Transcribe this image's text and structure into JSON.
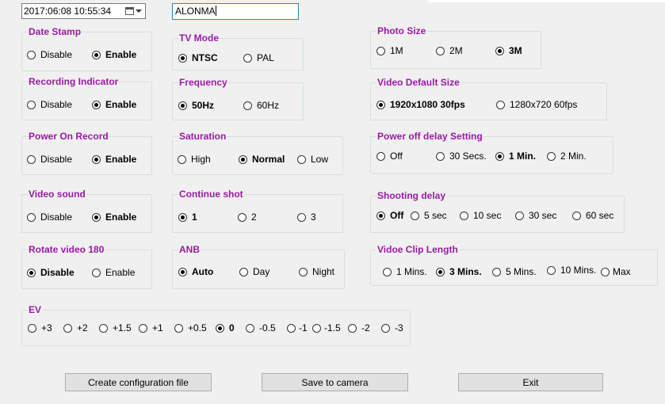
{
  "datetime_field": {
    "value": "2017:06:08 10:55:34"
  },
  "name_field": {
    "value": "ALONMA"
  },
  "groups": {
    "date_stamp": {
      "title": "Date Stamp",
      "options": [
        "Disable",
        "Enable"
      ]
    },
    "tv_mode": {
      "title": "TV Mode",
      "options": [
        "NTSC",
        "PAL"
      ]
    },
    "photo_size": {
      "title": "Photo Size",
      "options": [
        "1M",
        "2M",
        "3M"
      ]
    },
    "recording_indicator": {
      "title": "Recording Indicator",
      "options": [
        "Disable",
        "Enable"
      ]
    },
    "frequency": {
      "title": "Frequency",
      "options": [
        "50Hz",
        "60Hz"
      ]
    },
    "video_default_size": {
      "title": "Video Default Size",
      "options": [
        "1920x1080 30fps",
        "1280x720 60fps"
      ]
    },
    "power_on_record": {
      "title": "Power On Record",
      "options": [
        "Disable",
        "Enable"
      ]
    },
    "saturation": {
      "title": "Saturation",
      "options": [
        "High",
        "Normal",
        "Low"
      ]
    },
    "power_off_delay": {
      "title": "Power off delay Setting",
      "options": [
        "Off",
        "30 Secs.",
        "1 Min.",
        "2 Min."
      ]
    },
    "video_sound": {
      "title": "Video sound",
      "options": [
        "Disable",
        "Enable"
      ]
    },
    "continue_shot": {
      "title": "Continue shot",
      "options": [
        "1",
        "2",
        "3"
      ]
    },
    "shooting_delay": {
      "title": "Shooting delay",
      "options": [
        "Off",
        "5 sec",
        "10 sec",
        "30 sec",
        "60 sec"
      ]
    },
    "rotate_video": {
      "title": "Rotate video 180",
      "options": [
        "Disable",
        "Enable"
      ]
    },
    "anb": {
      "title": "ANB",
      "options": [
        "Auto",
        "Day",
        "Night"
      ]
    },
    "video_clip_length": {
      "title": "Vidoe Clip Length",
      "options": [
        "1 Mins.",
        "3 Mins.",
        "5 Mins.",
        "10 Mins.",
        "Max"
      ]
    },
    "ev": {
      "title": "EV",
      "options": [
        "+3",
        "+2",
        "+1.5",
        "+1",
        "+0.5",
        "0",
        "-0.5",
        "-1",
        "-1.5",
        "-2",
        "-3"
      ]
    }
  },
  "selected": {
    "date_stamp": "Enable",
    "tv_mode": "NTSC",
    "photo_size": "3M",
    "recording_indicator": "Enable",
    "frequency": "50Hz",
    "video_default_size": "1920x1080 30fps",
    "power_on_record": "Enable",
    "saturation": "Normal",
    "power_off_delay": "1 Min.",
    "video_sound": "Enable",
    "continue_shot": "1",
    "shooting_delay": "Off",
    "rotate_video": "Disable",
    "anb": "Auto",
    "video_clip_length": "3 Mins.",
    "ev": "0"
  },
  "buttons": {
    "create_config": "Create configuration file",
    "save_to_camera": "Save to camera",
    "exit": "Exit"
  },
  "icons": {
    "date_picker": "calendar-icon",
    "dropdown": "chevron-down-icon"
  }
}
